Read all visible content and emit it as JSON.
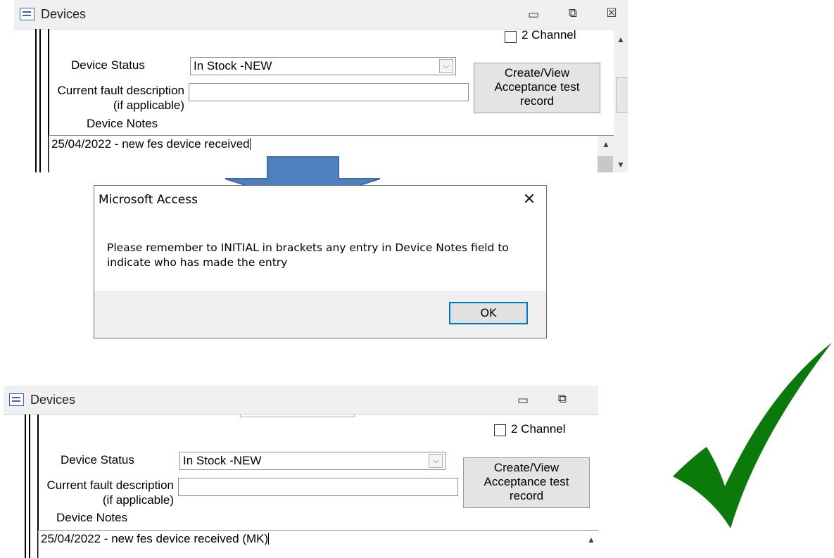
{
  "top_form": {
    "window_title": "Devices",
    "minimize_symbol": "▭",
    "restore_symbol": "⧉",
    "close_symbol": "☒",
    "two_channel_label": "2 Channel",
    "device_status_label": "Device Status",
    "device_status_value": "In Stock -NEW",
    "fault_label_line1": "Current fault description",
    "fault_label_line2": "(if applicable)",
    "fault_value": "",
    "acceptance_button": [
      "Create/View",
      "Acceptance test",
      "record"
    ],
    "device_notes_label": "Device Notes",
    "device_notes_value": "25/04/2022 - new fes device received"
  },
  "arrow_color": "#4f7fbf",
  "dialog": {
    "title": "Microsoft Access",
    "message_line1": "Please remember to INITIAL in brackets any entry in Device Notes field to",
    "message_line2": "indicate who has made the entry",
    "ok_label": "OK",
    "close_symbol": "✕"
  },
  "bottom_form": {
    "window_title": "Devices",
    "minimize_symbol": "▭",
    "restore_symbol": "⧉",
    "two_channel_label": "2 Channel",
    "device_status_label": "Device Status",
    "device_status_value": "In Stock -NEW",
    "fault_label_line1": "Current fault description",
    "fault_label_line2": "(if applicable)",
    "fault_value": "",
    "acceptance_button": [
      "Create/View",
      "Acceptance test",
      "record"
    ],
    "device_notes_label": "Device Notes",
    "device_notes_value": "25/04/2022 - new fes device received (MK)"
  },
  "checkmark_color": "#0a7a0a"
}
